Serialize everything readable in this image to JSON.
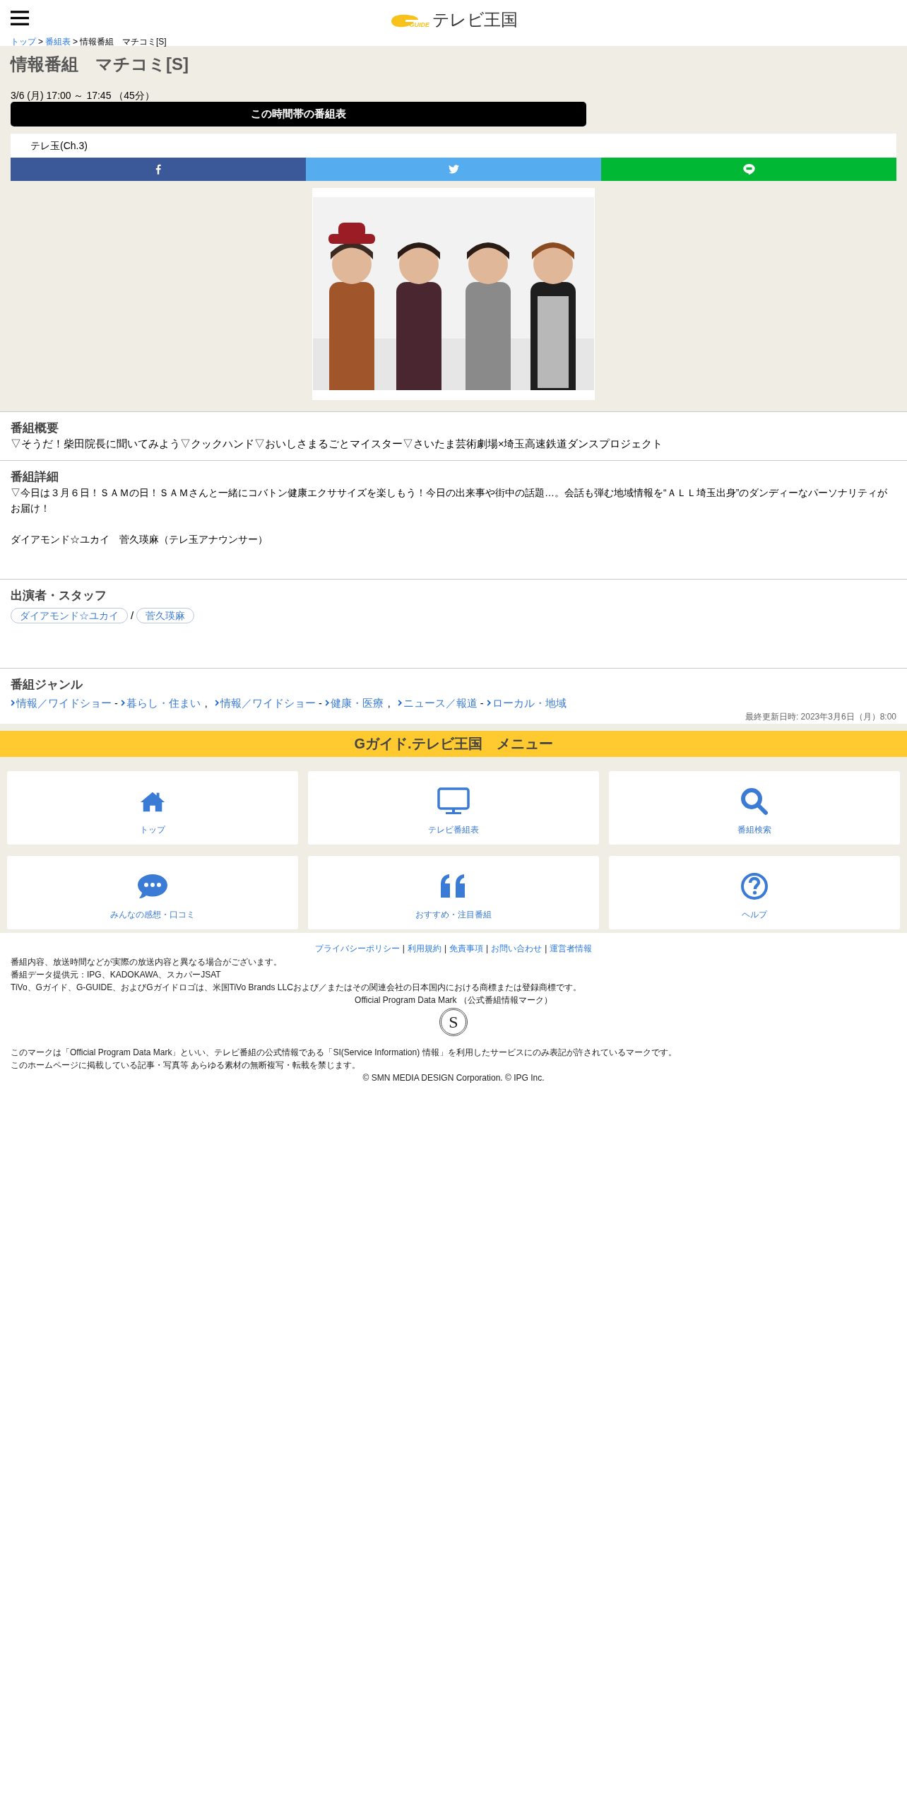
{
  "header": {
    "logo_badge": "GUIDE",
    "logo_text": "テレビ王国"
  },
  "breadcrumb": {
    "separator": ">",
    "items": [
      {
        "label": "トップ",
        "kind": "link"
      },
      {
        "label": "番組表",
        "kind": "link"
      },
      {
        "label": "情報番組　マチコミ[S]",
        "kind": "current"
      }
    ]
  },
  "program": {
    "title": "情報番組　マチコミ[S]",
    "airtime": "3/6 (月) 17:00 ～ 17:45 （45分）",
    "schedule_button": "この時間帯の番組表",
    "channel": "テレ玉(Ch.3)",
    "share_buttons": [
      {
        "kind": "facebook"
      },
      {
        "kind": "twitter"
      },
      {
        "kind": "line"
      }
    ]
  },
  "overview": {
    "heading": "番組概要",
    "text": "▽そうだ！柴田院長に聞いてみよう▽クックハンド▽おいしさまるごとマイスター▽さいたま芸術劇場×埼玉高速鉄道ダンスプロジェクト"
  },
  "detail": {
    "heading": "番組詳細",
    "paragraphs": [
      "▽今日は３月６日！ＳＡＭの日！ＳＡＭさんと一緒にコバトン健康エクササイズを楽しもう！今日の出来事や街中の話題…。会話も弾む地域情報を“ＡＬＬ埼玉出身”のダンディーなパーソナリティがお届け！",
      "ダイアモンド☆ユカイ　菅久瑛麻（テレ玉アナウンサー）"
    ]
  },
  "cast": {
    "heading": "出演者・スタッフ",
    "separator": "/",
    "people": [
      "ダイアモンド☆ユカイ",
      "菅久瑛麻"
    ]
  },
  "genre": {
    "heading": "番組ジャンル",
    "link_separator": "-",
    "group_separator": ",",
    "groups": [
      [
        "情報／ワイドショー",
        "暮らし・住まい"
      ],
      [
        "情報／ワイドショー",
        "健康・医療"
      ],
      [
        "ニュース／報道",
        "ローカル・地域"
      ]
    ],
    "last_updated": "最終更新日時: 2023年3月6日（月）8:00"
  },
  "menu": {
    "title": "Gガイド.テレビ王国　メニュー",
    "items": [
      {
        "kind": "home",
        "label": "トップ"
      },
      {
        "kind": "tv",
        "label": "テレビ番組表"
      },
      {
        "kind": "search",
        "label": "番組検索"
      },
      {
        "kind": "chat",
        "label": "みんなの感想・口コミ"
      },
      {
        "kind": "quote",
        "label": "おすすめ・注目番組"
      },
      {
        "kind": "help",
        "label": "ヘルプ"
      }
    ]
  },
  "footer": {
    "separator": "|",
    "links": [
      "プライバシーポリシー",
      "利用規約",
      "免責事項",
      "お問い合わせ",
      "運営者情報"
    ],
    "notes": [
      "番組内容、放送時間などが実際の放送内容と異なる場合がございます。",
      "番組データ提供元：IPG、KADOKAWA、スカパーJSAT",
      "TiVo、Gガイド、G-GUIDE、およびGガイドロゴは、米国TiVo Brands LLCおよび／またはその関連会社の日本国内における商標または登録商標です。"
    ],
    "mark_caption": "Official Program Data Mark （公式番組情報マーク）",
    "mark_letter": "S",
    "mark_notes": [
      "このマークは「Official Program Data Mark」といい、テレビ番組の公式情報である「SI(Service Information) 情報」を利用したサービスにのみ表記が許されているマークです。",
      "このホームページに掲載している記事・写真等 あらゆる素材の無断複写・転載を禁じます。"
    ],
    "copyright": "© SMN MEDIA DESIGN Corporation. © IPG Inc."
  }
}
